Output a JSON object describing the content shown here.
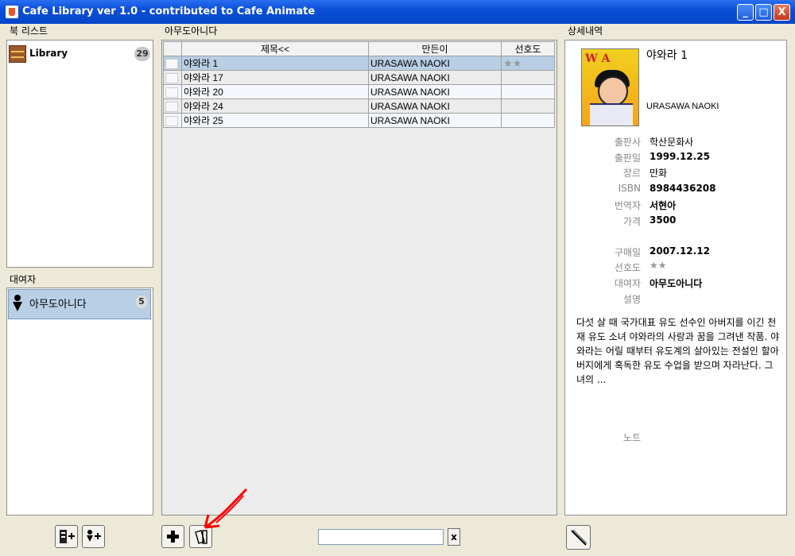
{
  "window": {
    "title": "Cafe Library ver 1.0 - contributed to Cafe Animate",
    "min_label": "_",
    "max_label": "□",
    "close_label": "X"
  },
  "booklist": {
    "heading": "북 리스트",
    "items": [
      {
        "label": "Library",
        "count": "29",
        "icon": "bookshelf-icon"
      }
    ]
  },
  "borrowers": {
    "heading": "대여자",
    "items": [
      {
        "label": "아무도아니다",
        "count": "5",
        "icon": "person-icon"
      }
    ]
  },
  "books": {
    "heading": "아무도아니다",
    "columns": [
      "",
      "제목<<",
      "만든이",
      "선호도"
    ],
    "rows": [
      {
        "title": "야와라 1",
        "author": "URASAWA NAOKI",
        "rating": "★★",
        "selected": true
      },
      {
        "title": "야와라 17",
        "author": "URASAWA NAOKI",
        "rating": "",
        "selected": false
      },
      {
        "title": "야와라 20",
        "author": "URASAWA NAOKI",
        "rating": "",
        "selected": false
      },
      {
        "title": "야와라 24",
        "author": "URASAWA NAOKI",
        "rating": "",
        "selected": false
      },
      {
        "title": "야와라 25",
        "author": "URASAWA NAOKI",
        "rating": "",
        "selected": false
      }
    ]
  },
  "detail": {
    "heading": "상세내역",
    "title": "야와라 1",
    "author": "URASAWA NAOKI",
    "fields": [
      {
        "label": "출판사",
        "value": "학산문화사"
      },
      {
        "label": "출판일",
        "value": "1999.12.25"
      },
      {
        "label": "장르",
        "value": "만화"
      },
      {
        "label": "ISBN",
        "value": "8984436208"
      },
      {
        "label": "번역자",
        "value": "서현아"
      },
      {
        "label": "가격",
        "value": "3500"
      }
    ],
    "fields2": [
      {
        "label": "구매일",
        "value": "2007.12.12"
      },
      {
        "label": "선호도",
        "value": "★★"
      },
      {
        "label": "대여자",
        "value": "아무도아니다"
      },
      {
        "label": "설명",
        "value": ""
      }
    ],
    "description": "다섯 살 때 국가대표 유도 선수인 아버지를 이긴 천재 유도 소녀 야와라의 사랑과 꿈을 그려낸 작품. 야와라는 어릴 때부터 유도계의 살아있는 전설인 할아버지에게 혹독한 유도 수업을 받으며 자라난다. 그녀의 ...",
    "note_label": "노트"
  },
  "toolbar": {
    "search_value": "",
    "clear_label": "x"
  },
  "colors": {
    "selection": "#b8cfe5",
    "annotation_arrow": "#ff0000"
  }
}
